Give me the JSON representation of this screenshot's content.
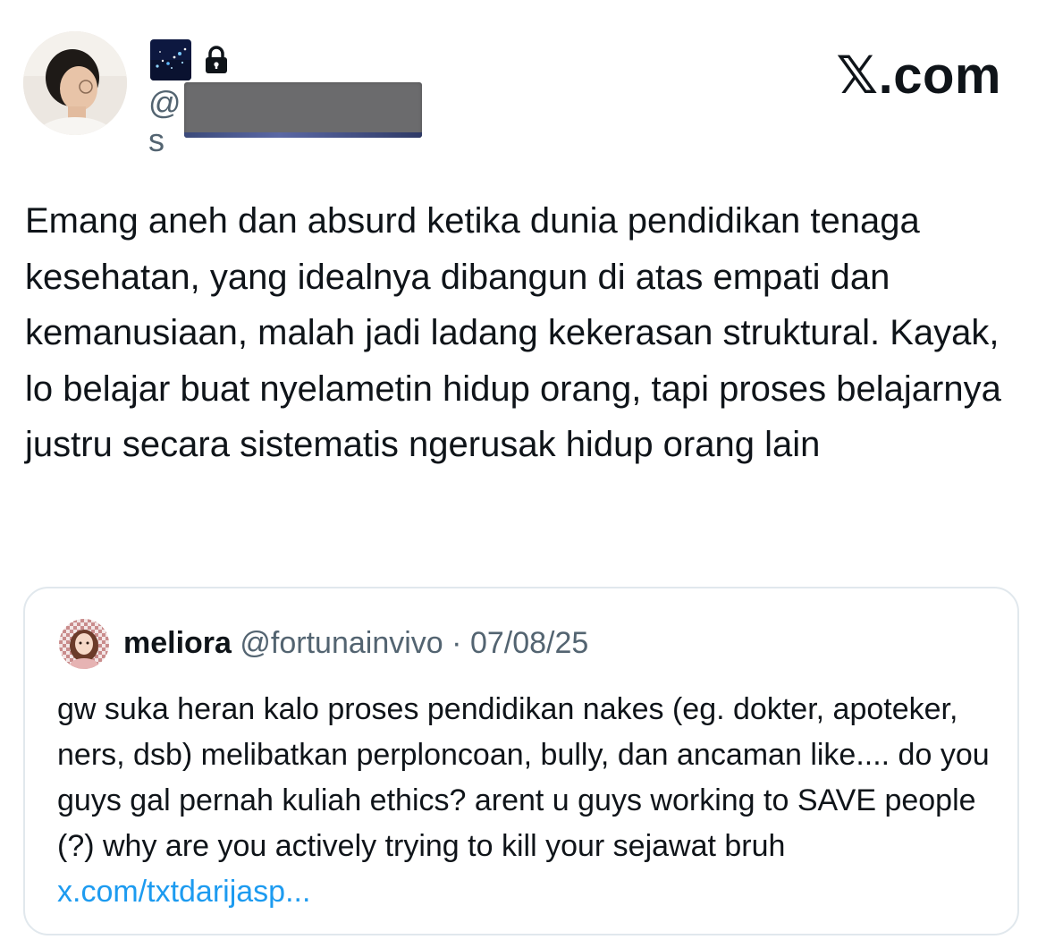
{
  "author": {
    "handle_prefix": "@",
    "handle_suffix": "s",
    "avatar_icon": "profile-photo",
    "badge_icon": "galaxy-emoji",
    "protected_icon": "lock-icon"
  },
  "brand": {
    "label": "𝕏.com"
  },
  "tweet": {
    "text": "Emang aneh dan absurd ketika dunia pendidikan tenaga kesehatan, yang idealnya dibangun di atas empati dan kemanusiaan, malah jadi ladang kekerasan struktural. Kayak, lo belajar buat nyelametin hidup orang, tapi proses belajarnya justru secara sistematis ngerusak hidup orang lain"
  },
  "quote": {
    "name": "meliora",
    "handle": "@fortunainvivo",
    "separator": "·",
    "date": "07/08/25",
    "text": "gw suka heran kalo proses pendidikan nakes (eg. dokter, apoteker, ners, dsb) melibatkan perploncoan, bully, dan ancaman like.... do you guys gal pernah kuliah ethics? arent u guys working to SAVE people (?) why are you actively trying to kill your sejawat bruh ",
    "link_text": "x.com/txtdarijasp...",
    "link_color": "#1d9bf0"
  },
  "colors": {
    "text": "#0f1419",
    "secondary": "#536471",
    "border": "#e1e8ed"
  }
}
